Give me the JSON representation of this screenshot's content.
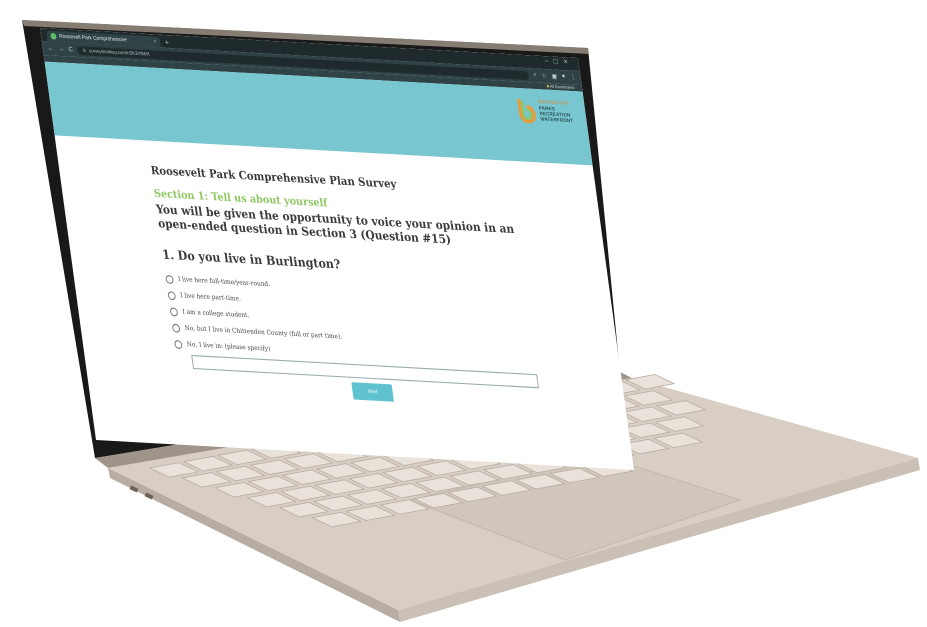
{
  "browser": {
    "tab_title": "Roosevelt Park Comprehensive",
    "tab_close": "×",
    "new_tab": "+",
    "window_controls": "–▢✕",
    "nav_back": "←",
    "nav_forward": "→",
    "nav_reload": "C",
    "url": "surveymonkey.com/r/2K3Y9WX",
    "bookmarks_label": "All Bookmarks"
  },
  "site": {
    "logo": {
      "city": "BURLINGTON",
      "lines": [
        "PARKS",
        "RECREATION",
        "WATERFRONT"
      ]
    }
  },
  "survey": {
    "title": "Roosevelt Park Comprehensive Plan Survey",
    "section_title": "Section 1: Tell us about yourself",
    "intro": "You will be given the opportunity to voice your opinion in an open-ended question in Section 3 (Question #15)",
    "question": "1. Do you live in Burlington?",
    "options": [
      "I live here full-time/year-round.",
      "I live here part-time.",
      "I am a college student.",
      "No, but I live in Chittenden County (full or part time).",
      "No, I live in: (please specify)"
    ],
    "next_label": "Next"
  },
  "colors": {
    "header": "#78c6cf",
    "section_green": "#8fc763",
    "button": "#5ec3cf",
    "chrome_dark": "#1f2a2c"
  }
}
